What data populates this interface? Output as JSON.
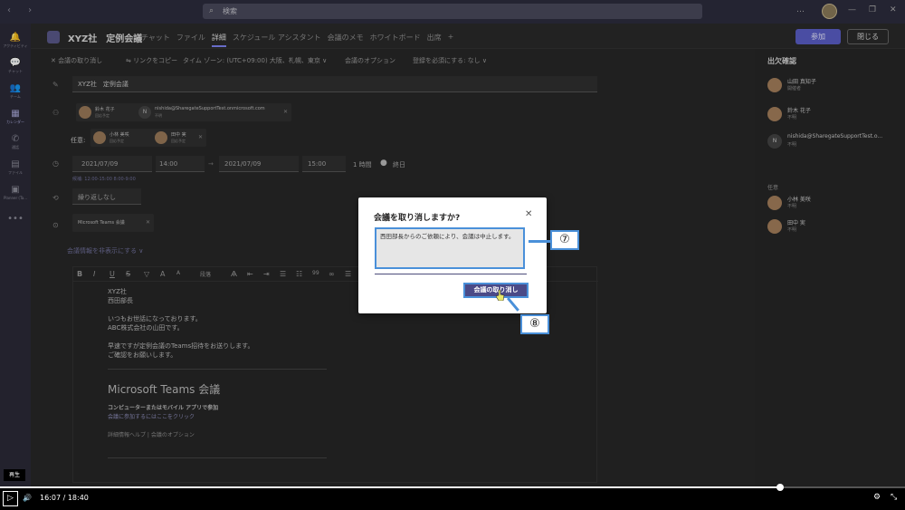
{
  "titlebar": {
    "nav": "‹ ›",
    "search_placeholder": "検索",
    "win_controls": [
      "…",
      "—",
      "❐",
      "✕"
    ]
  },
  "rail": [
    {
      "icon": "bell-icon",
      "glyph": "🔔",
      "label": "アクティビティ"
    },
    {
      "icon": "chat-icon",
      "glyph": "💬",
      "label": "チャット"
    },
    {
      "icon": "teams-icon",
      "glyph": "👥",
      "label": "チーム"
    },
    {
      "icon": "calendar-icon",
      "glyph": "▦",
      "label": "カレンダー",
      "active": true
    },
    {
      "icon": "call-icon",
      "glyph": "✆",
      "label": "通話"
    },
    {
      "icon": "files-icon",
      "glyph": "▤",
      "label": "ファイル"
    },
    {
      "icon": "planner-icon",
      "glyph": "▣",
      "label": "Planner (Ta..."
    },
    {
      "icon": "more-icon",
      "glyph": "•••",
      "label": ""
    }
  ],
  "meeting": {
    "title": "XYZ社　定例会議",
    "tabs": [
      "チャット",
      "ファイル",
      "詳細",
      "スケジュール アシスタント",
      "会議のメモ",
      "ホワイトボード",
      "出席",
      "+"
    ],
    "active_tab": "詳細",
    "join_label": "参加",
    "close_label": "閉じる"
  },
  "toolbar": {
    "cancel": "✕ 会議の取り消し",
    "copy_link": "⇋ リンクをコピー",
    "timezone": "タイム ゾーン: (UTC+09:00) 大阪、札幌、東京 ∨",
    "options": "会議のオプション",
    "registration": "登録を必須にする: なし ∨"
  },
  "form": {
    "title_value": "XYZ社　定例会議",
    "required_label": "",
    "attendees": [
      {
        "name": "鈴木 花子",
        "status": "回応予定"
      },
      {
        "name": "nishida@SharegateSupportTest.onmicrosoft.com",
        "status": "不明",
        "initial": "N"
      }
    ],
    "optional_label": "任意:",
    "optional": [
      {
        "name": "小林 美咲",
        "status": "回応予定"
      },
      {
        "name": "田中 実",
        "status": "回応予定"
      }
    ],
    "start_date": "2021/07/09",
    "start_time": "14:00",
    "end_date": "2021/07/09",
    "end_time": "15:00",
    "duration": "1 時間",
    "allday": "終日",
    "suggestion": "候補: 12:00-15:00  8:00-9:00",
    "repeat": "繰り返しなし",
    "location": "Microsoft Teams 会議",
    "hide_details": "会議情報を非表示にする ∨"
  },
  "editor": {
    "fmt_buttons": [
      "B",
      "I",
      "U",
      "S",
      "▽",
      "A",
      "A",
      "段落",
      "Ѧ",
      "⇤",
      "⇥",
      "☰",
      "☷",
      "99",
      "∞",
      "☰",
      "⊞",
      "↶"
    ],
    "lines": [
      "XYZ社",
      "西田部長",
      "",
      "いつもお世話になっております。",
      "ABC株式会社の山田です。",
      "",
      "早速ですが定例会議のTeams招待をお送りします。",
      "ご確認をお願いします。"
    ],
    "teams_heading": "Microsoft Teams 会議",
    "join_pc": "コンピューターまたはモバイル アプリで参加",
    "join_click": "会議に参加するにはここをクリック",
    "help": "詳細情報ヘルプ | 会議のオプション"
  },
  "attendance": {
    "title": "出欠確認",
    "required": [
      {
        "name": "山田 真知子",
        "status": "開催者"
      },
      {
        "name": "鈴木 花子",
        "status": "不明"
      },
      {
        "name": "nishida@SharegateSupportTest.o...",
        "status": "不明",
        "initial": "N"
      }
    ],
    "optional_label": "任意",
    "optional": [
      {
        "name": "小林 美咲",
        "status": "不明"
      },
      {
        "name": "田中 実",
        "status": "不明"
      }
    ]
  },
  "dialog": {
    "title": "会議を取り消しますか?",
    "close": "✕",
    "message": "西田部長からのご依頼により、会議は中止します。",
    "button": "会議の取り消し"
  },
  "callouts": {
    "seven": "⑦",
    "eight": "⑧"
  },
  "video": {
    "tooltip": "再生",
    "play": "▷",
    "volume": "🔊",
    "time": "16:07  /  18:40",
    "progress": 0.862,
    "settings": "⚙",
    "minimize": "⤡"
  },
  "colors": {
    "accent": "#5b5fc7",
    "callout": "#4a90d9",
    "dialog_button": "#4b4a87"
  }
}
